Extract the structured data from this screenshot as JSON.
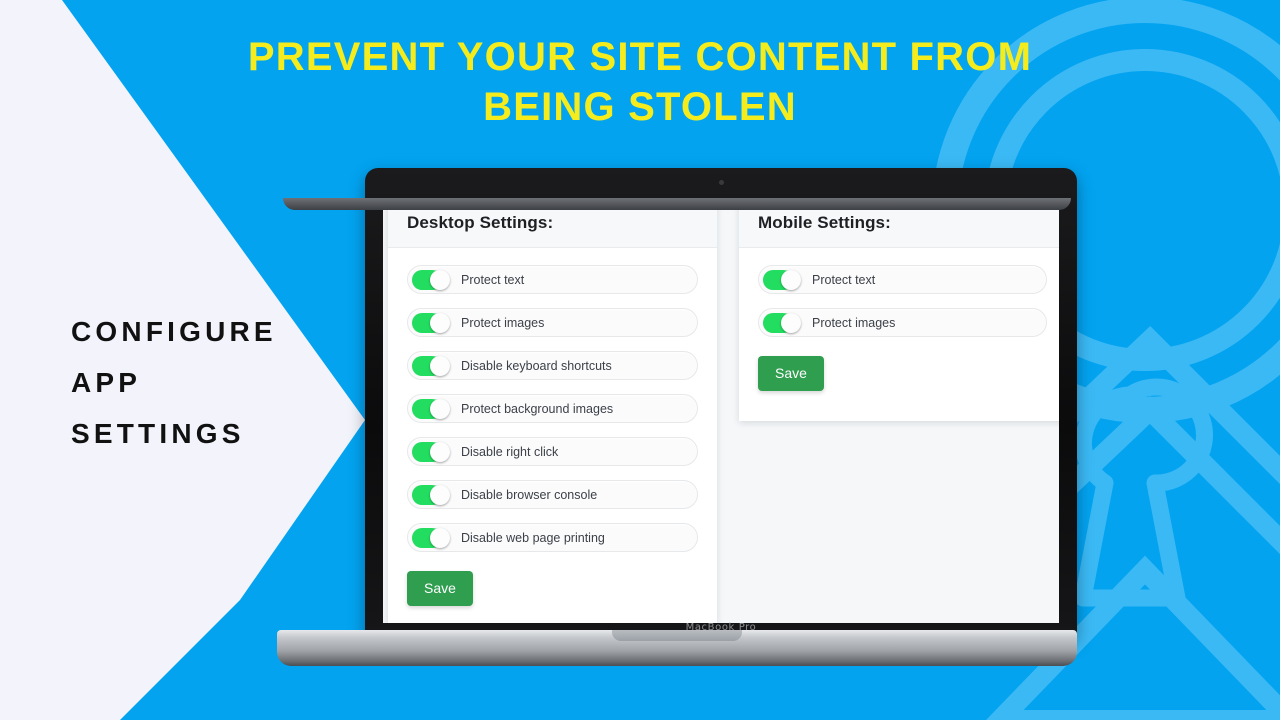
{
  "theme": {
    "brand_blue": "#03a3f0",
    "accent_blue_light": "#3bb9f5",
    "headline_yellow": "#f5ec1d",
    "panel_white": "#f2f3fb",
    "toggle_green": "#22dd5f",
    "save_green": "#2f9e4f"
  },
  "headline": {
    "line1": "PREVENT YOUR SITE CONTENT FROM",
    "line2": "BEING STOLEN"
  },
  "caption": {
    "line1": "CONFIGURE",
    "line2": "APP",
    "line3": "SETTINGS"
  },
  "device": {
    "model_label": "MacBook Pro"
  },
  "app": {
    "desktop_panel": {
      "title": "Desktop Settings:",
      "settings": [
        {
          "label": "Protect text",
          "enabled": true
        },
        {
          "label": "Protect images",
          "enabled": true
        },
        {
          "label": "Disable keyboard shortcuts",
          "enabled": true
        },
        {
          "label": "Protect background images",
          "enabled": true
        },
        {
          "label": "Disable right click",
          "enabled": true
        },
        {
          "label": "Disable browser console",
          "enabled": true
        },
        {
          "label": "Disable web page printing",
          "enabled": true
        }
      ],
      "save_label": "Save"
    },
    "mobile_panel": {
      "title": "Mobile Settings:",
      "settings": [
        {
          "label": "Protect text",
          "enabled": true
        },
        {
          "label": "Protect images",
          "enabled": true
        }
      ],
      "save_label": "Save"
    }
  }
}
